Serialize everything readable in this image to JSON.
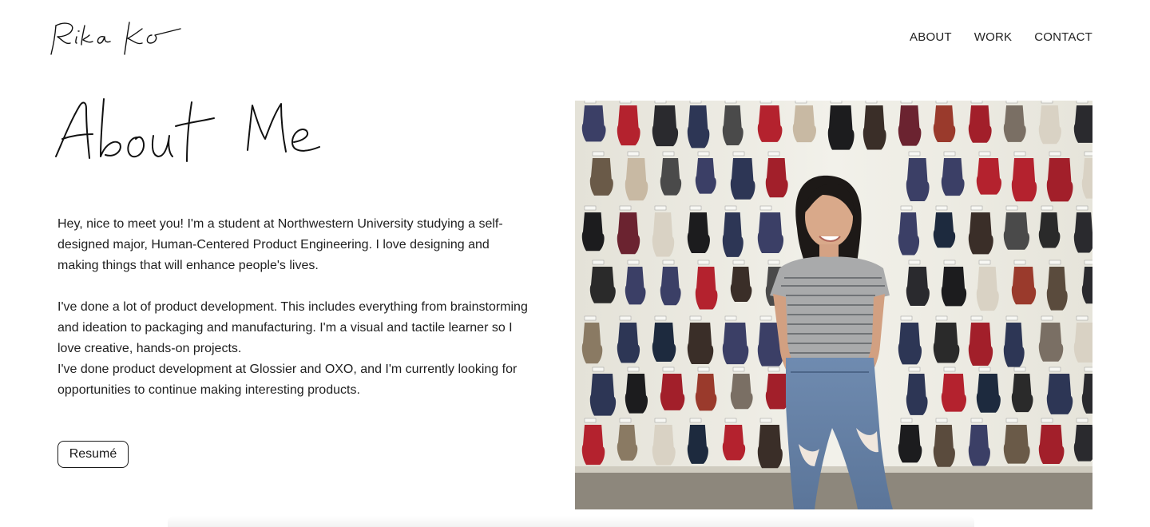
{
  "header": {
    "logo_text": "Rika Ko",
    "nav": [
      {
        "label": "ABOUT"
      },
      {
        "label": "WORK"
      },
      {
        "label": "CONTACT"
      }
    ]
  },
  "main": {
    "heading": "About Me",
    "paragraph_1": "Hey, nice to meet you! I'm a student at Northwestern University studying a self-designed major, Human-Centered Product Engineering. I love designing and making things that will enhance people's lives.",
    "paragraph_2": "I've done a lot of product development. This includes everything from brainstorming and ideation to packaging and manufacturing. I'm a visual and tactile learner so I love creative, hands-on projects.",
    "paragraph_3": "I've done product development at Glossier and OXO, and I'm currently looking for opportunities to continue making interesting products.",
    "resume_label": "Resumé"
  },
  "photo": {
    "subject": "woman-standing-in-front-of-glove-wall"
  },
  "colors": {
    "text": "#1a1a1a",
    "background": "#ffffff",
    "wall": "#ecebe4",
    "floor": "#8f8a80"
  }
}
